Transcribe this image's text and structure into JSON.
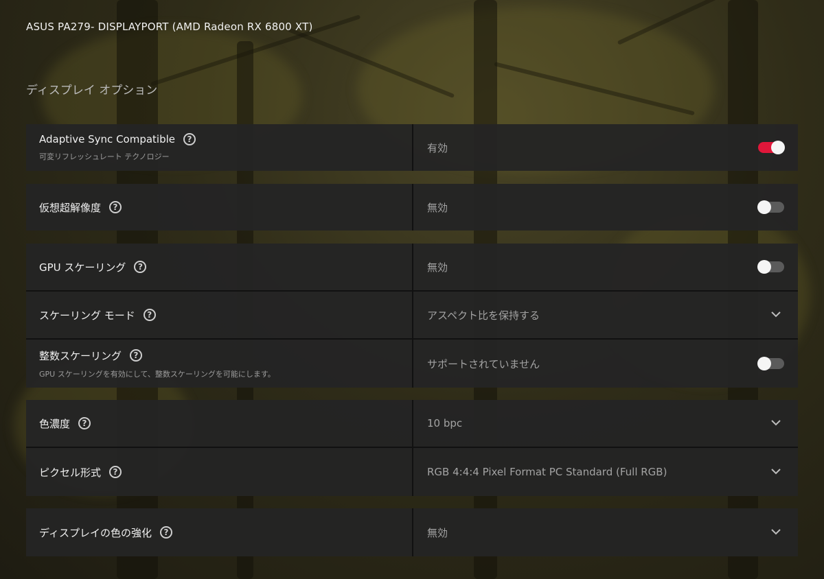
{
  "header": {
    "device_title": "ASUS PA279- DISPLAYPORT (AMD Radeon RX 6800 XT)",
    "section_title": "ディスプレイ オプション"
  },
  "rows": {
    "adaptive_sync": {
      "label": "Adaptive Sync Compatible",
      "sublabel": "可変リフレッシュレート テクノロジー",
      "value": "有効",
      "toggle_on": true
    },
    "vsr": {
      "label": "仮想超解像度",
      "value": "無効",
      "toggle_on": false
    },
    "gpu_scaling": {
      "label": "GPU スケーリング",
      "value": "無効",
      "toggle_on": false
    },
    "scaling_mode": {
      "label": "スケーリング モード",
      "value": "アスペクト比を保持する"
    },
    "integer_scaling": {
      "label": "整数スケーリング",
      "sublabel": "GPU スケーリングを有効にして、整数スケーリングを可能にします。",
      "value": "サポートされていません",
      "toggle_on": false
    },
    "color_depth": {
      "label": "色濃度",
      "value": "10 bpc"
    },
    "pixel_format": {
      "label": "ピクセル形式",
      "value": "RGB 4:4:4 Pixel Format PC Standard (Full RGB)"
    },
    "color_enhancement": {
      "label": "ディスプレイの色の強化",
      "value": "無効"
    }
  },
  "icons": {
    "help": "help-icon",
    "chevron": "chevron-down-icon",
    "help_glyph": "?"
  },
  "colors": {
    "accent_red": "#e0173a",
    "toggle_off": "#5b5b5b",
    "row_bg": "#242424"
  }
}
